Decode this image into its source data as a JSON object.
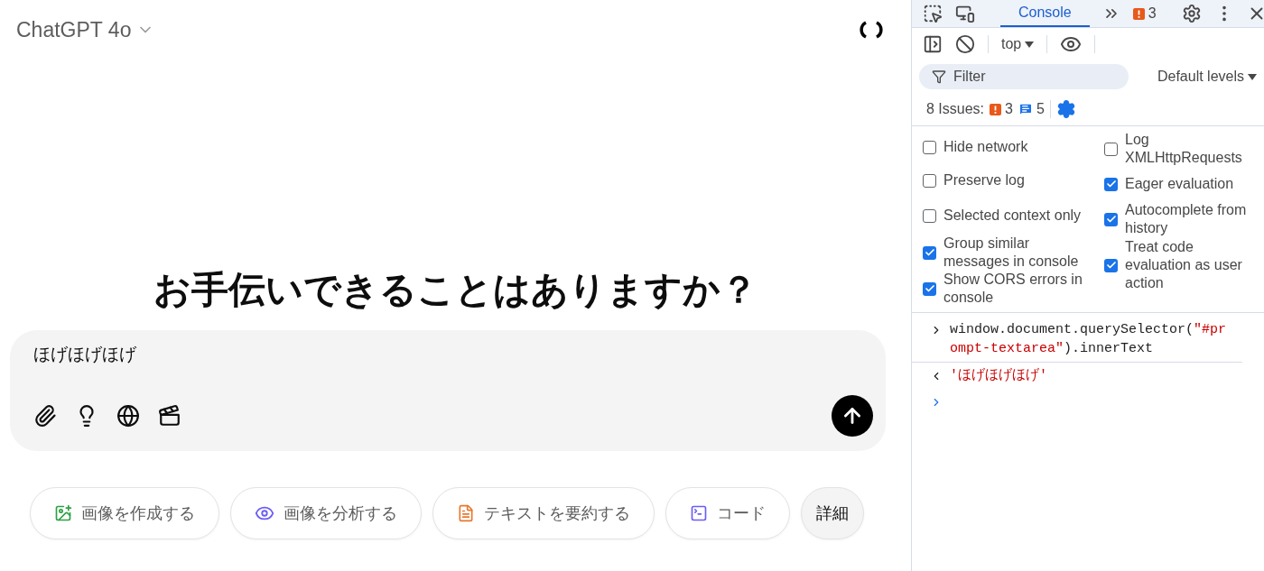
{
  "chat": {
    "model": "ChatGPT 4o",
    "heading": "お手伝いできることはありますか？",
    "prompt": {
      "value": "ほげほげほげ"
    },
    "suggestions": [
      {
        "label": "画像を作成する",
        "kind": "image"
      },
      {
        "label": "画像を分析する",
        "kind": "eye"
      },
      {
        "label": "テキストを要約する",
        "kind": "doc"
      },
      {
        "label": "コード",
        "kind": "code"
      },
      {
        "label": "詳細",
        "kind": "more"
      }
    ]
  },
  "devtools": {
    "tabs": [
      {
        "label": "Console",
        "selected": true
      }
    ],
    "issue_badge": "3",
    "context": "top",
    "filter": {
      "placeholder": "Filter"
    },
    "levels": "Default levels",
    "issues": {
      "label": "8 Issues:",
      "warnings": "3",
      "infos": "5"
    },
    "settings_left": [
      {
        "label": "Hide network",
        "checked": false
      },
      {
        "label": "Preserve log",
        "checked": false
      },
      {
        "label": "Selected context only",
        "checked": false
      },
      {
        "label": "Group similar messages in console",
        "checked": true
      },
      {
        "label": "Show CORS errors in console",
        "checked": true
      }
    ],
    "settings_right": [
      {
        "label": "Log XMLHttpRequests",
        "checked": false
      },
      {
        "label": "Eager evaluation",
        "checked": true
      },
      {
        "label": "Autocomplete from history",
        "checked": true
      },
      {
        "label": "Treat code evaluation as user action",
        "checked": true
      }
    ],
    "console": [
      {
        "kind": "input",
        "code": "window.document.querySelector(",
        "argument": "\"#prompt-textarea\"",
        "code_end": ").innerText"
      },
      {
        "kind": "output",
        "value": "'ほげほげほげ'"
      }
    ]
  }
}
